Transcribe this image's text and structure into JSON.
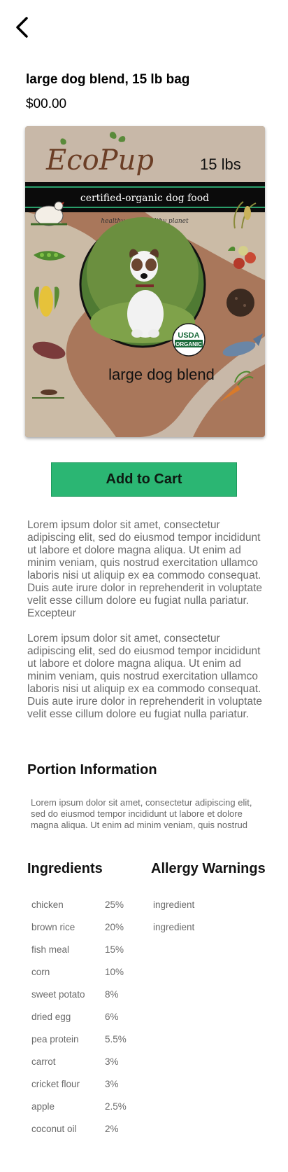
{
  "nav": {
    "back_icon": "chevron-left-icon"
  },
  "product": {
    "title": "large dog blend, 15 lb bag",
    "price": "$00.00"
  },
  "package": {
    "brand": "EcoPup",
    "weight": "15 lbs",
    "banner": "certified-organic dog food",
    "tagline": "healthy pup, healthy planet",
    "variant": "large dog blend",
    "seal_top": "USDA",
    "seal_bottom": "ORGANIC"
  },
  "actions": {
    "add_to_cart": "Add to Cart"
  },
  "description": [
    "Lorem ipsum dolor sit amet, consectetur adipiscing elit, sed do eiusmod tempor incididunt ut labore et dolore magna aliqua. Ut enim ad minim veniam, quis nostrud exercitation ullamco laboris nisi ut aliquip ex ea commodo consequat. Duis aute irure dolor in reprehenderit in voluptate velit esse cillum dolore eu fugiat nulla pariatur. Excepteur",
    "Lorem ipsum dolor sit amet, consectetur adipiscing elit, sed do eiusmod tempor incididunt ut labore et dolore magna aliqua. Ut enim ad minim veniam, quis nostrud exercitation ullamco laboris nisi ut aliquip ex ea commodo consequat. Duis aute irure dolor in reprehenderit in voluptate velit esse cillum dolore eu fugiat nulla pariatur."
  ],
  "portion": {
    "heading": "Portion Information",
    "text": "Lorem ipsum dolor sit amet, consectetur adipiscing elit, sed do eiusmod tempor incididunt ut labore et dolore magna aliqua. Ut enim ad minim veniam, quis nostrud"
  },
  "ingredients": {
    "heading": "Ingredients",
    "items": [
      {
        "name": "chicken",
        "percent": "25%"
      },
      {
        "name": "brown rice",
        "percent": "20%"
      },
      {
        "name": "fish meal",
        "percent": "15%"
      },
      {
        "name": "corn",
        "percent": "10%"
      },
      {
        "name": "sweet potato",
        "percent": "8%"
      },
      {
        "name": "dried egg",
        "percent": "6%"
      },
      {
        "name": "pea protein",
        "percent": "5.5%"
      },
      {
        "name": "carrot",
        "percent": "3%"
      },
      {
        "name": "cricket flour",
        "percent": "3%"
      },
      {
        "name": "apple",
        "percent": "2.5%"
      },
      {
        "name": "coconut oil",
        "percent": "2%"
      }
    ]
  },
  "allergy": {
    "heading": "Allergy Warnings",
    "items": [
      "ingredient",
      "ingredient"
    ]
  },
  "colors": {
    "add_to_cart": "#2bb673",
    "package_tan": "#c7b6a6",
    "package_brown": "#a9755a",
    "banner_black": "#0b0b0b",
    "banner_green": "#2a9d6a"
  }
}
